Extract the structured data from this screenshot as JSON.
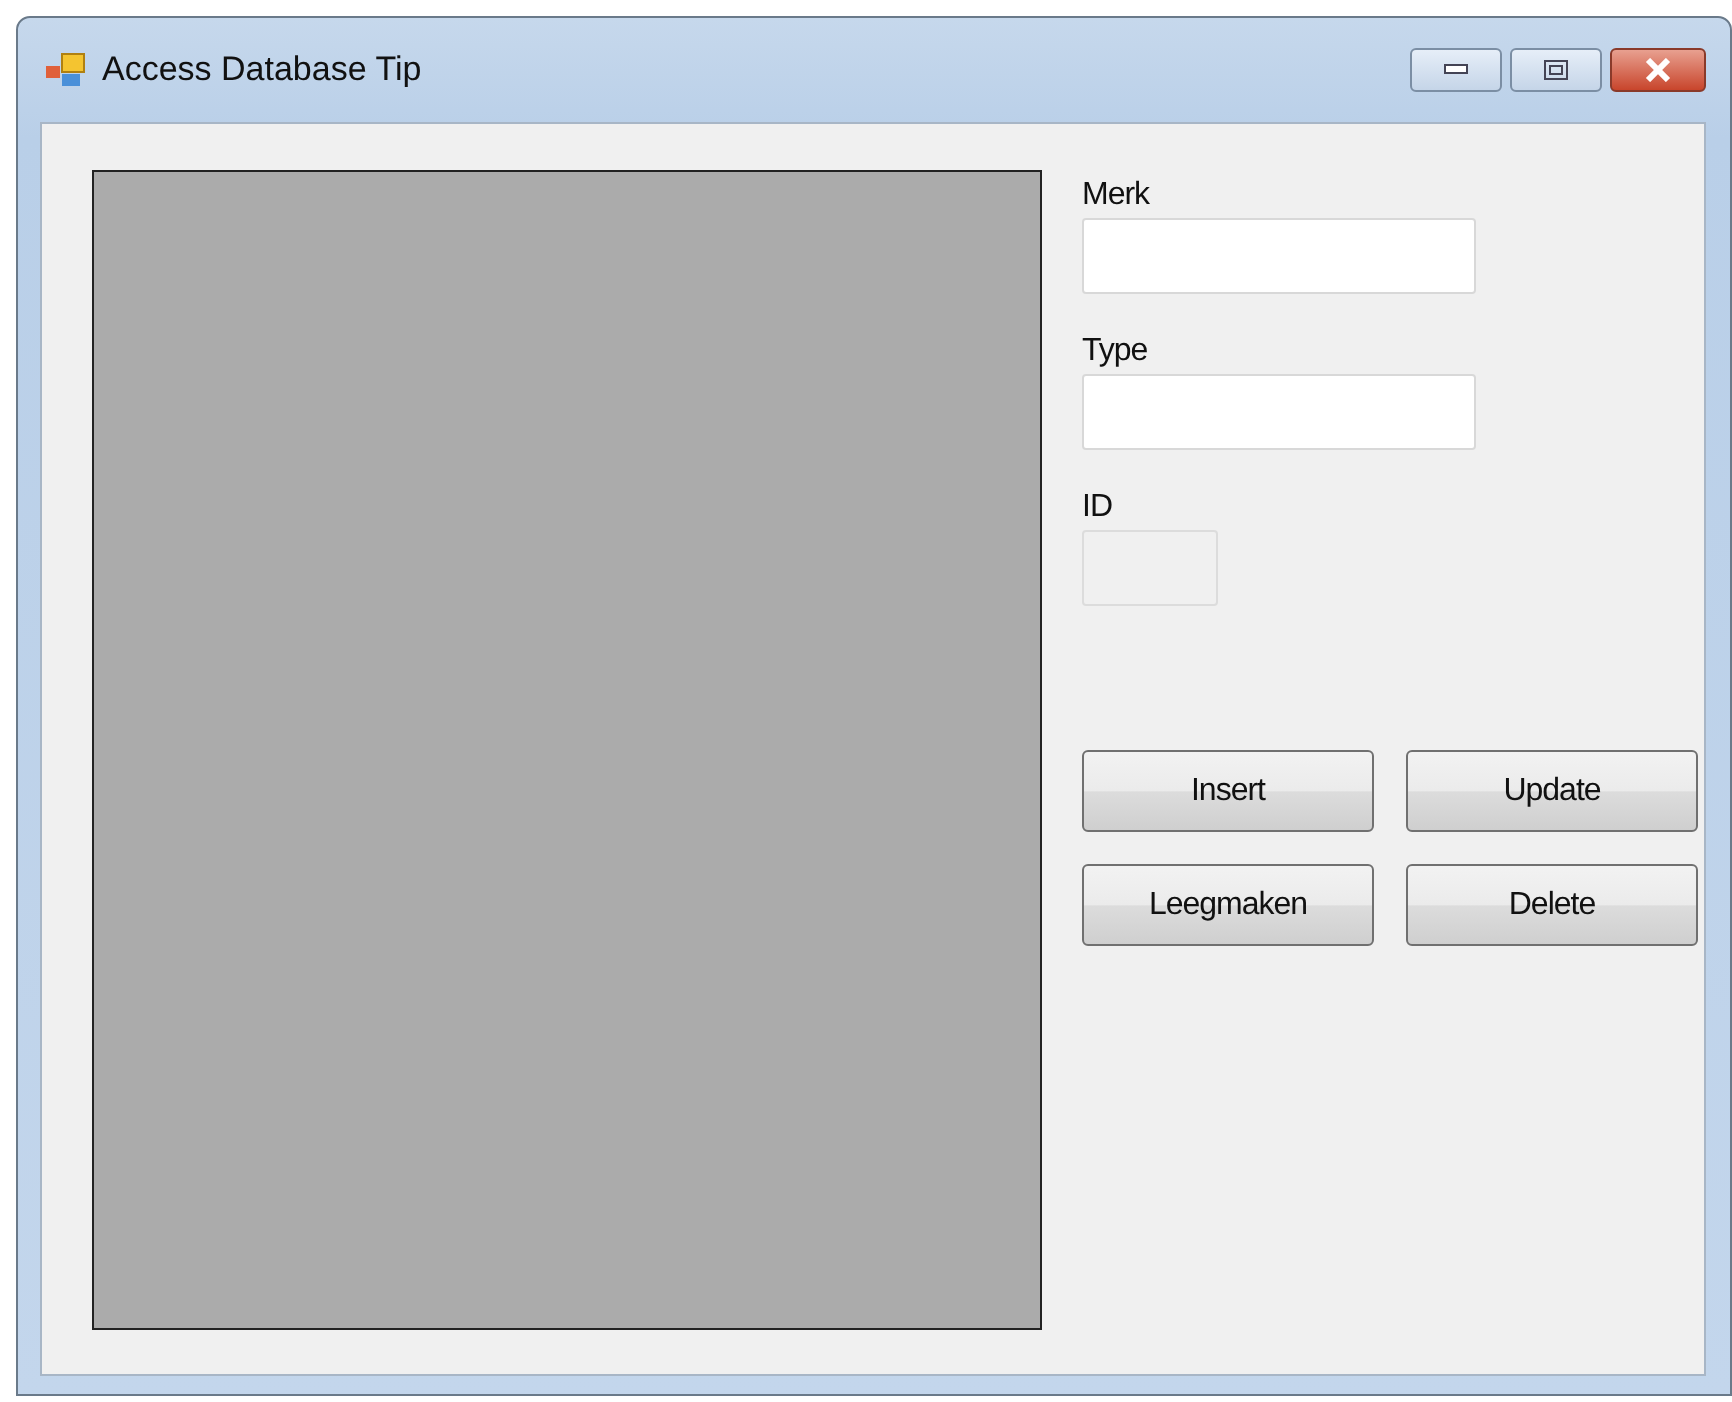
{
  "window": {
    "title": "Access Database Tip"
  },
  "fields": [
    {
      "label": "Merk",
      "disabled": false
    },
    {
      "label": "Type",
      "disabled": false
    },
    {
      "label": "ID",
      "disabled": true
    }
  ],
  "buttons": [
    "Insert",
    "Update",
    "Leegmaken",
    "Delete"
  ]
}
